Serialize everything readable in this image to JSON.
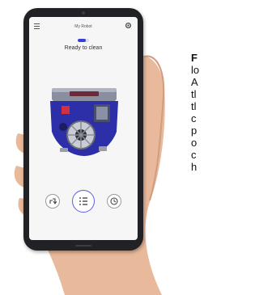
{
  "app": {
    "title": "My Robot",
    "status": "Ready to clean",
    "battery_level": 0.7,
    "accent_color": "#3a3fd8"
  },
  "icons": {
    "menu": "menu-icon",
    "settings": "gear-icon",
    "robot": "robot-vacuum-image",
    "left_button": "dock-icon",
    "center_button": "clean-list-icon",
    "right_button": "clock-icon"
  },
  "side_text": {
    "lines": [
      "F",
      "lo",
      "A",
      "tl",
      "tl",
      "c",
      "p",
      "o",
      "c",
      "h"
    ]
  }
}
